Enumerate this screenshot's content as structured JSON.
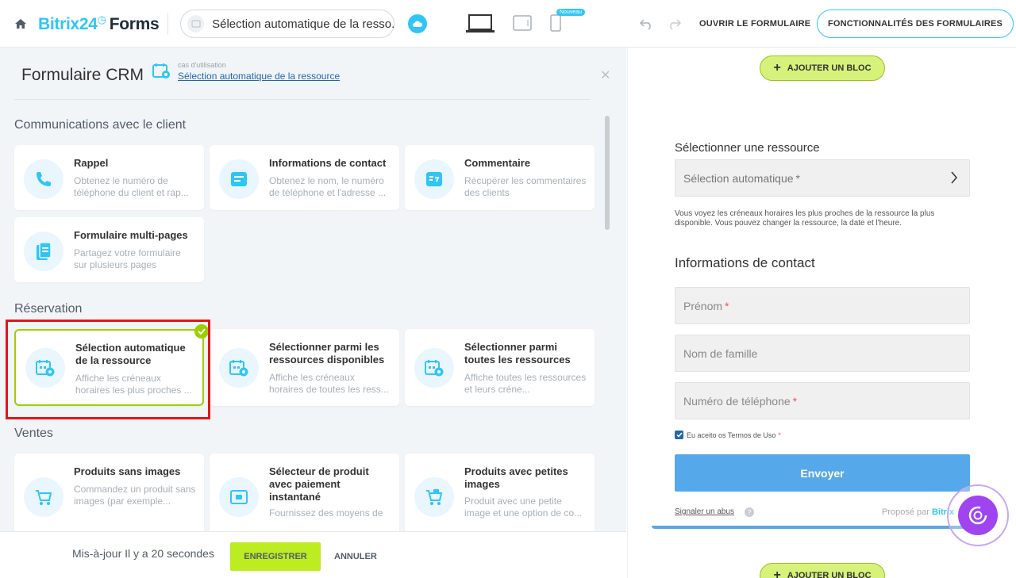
{
  "topbar": {
    "brand_name": "Bitrix24",
    "brand_forms": "Forms",
    "search_value": "Sélection automatique de la resso...",
    "new_badge": "Nouveau",
    "open_form": "OUVRIR LE FORMULAIRE",
    "features": "FONCTIONNALITÉS DES FORMULAIRES"
  },
  "left": {
    "title": "Formulaire CRM",
    "use_case_label": "cas d'utilisation",
    "use_case_link": "Sélection automatique de la ressource",
    "sections": [
      {
        "title": "Communications avec le client",
        "cards": [
          {
            "title": "Rappel",
            "desc": "Obtenez le numéro de téléphone du client et rap...",
            "icon": "phone-icon"
          },
          {
            "title": "Informations de contact",
            "desc": "Obtenez le nom, le numéro de téléphone et l'adresse ...",
            "icon": "contact-card-icon"
          },
          {
            "title": "Commentaire",
            "desc": "Récupérer les commentaires des clients",
            "icon": "comment-icon"
          },
          {
            "title": "Formulaire multi-pages",
            "desc": "Partagez votre formulaire sur plusieurs pages",
            "icon": "pages-icon"
          }
        ]
      },
      {
        "title": "Réservation",
        "cards": [
          {
            "title": "Sélection automatique de la ressource",
            "desc": "Affiche les créneaux horaires les plus proches ...",
            "icon": "calendar-resource-icon",
            "selected": true
          },
          {
            "title": "Sélectionner parmi les ressources disponibles",
            "desc": "Affiche les créneaux horaires de toutes les ress...",
            "icon": "calendar-resource-icon"
          },
          {
            "title": "Sélectionner parmi toutes les ressources",
            "desc": "Affiche toutes les ressources et leurs créne...",
            "icon": "calendar-resource-icon"
          }
        ]
      },
      {
        "title": "Ventes",
        "cards": [
          {
            "title": "Produits sans images",
            "desc": "Commandez un produit sans images (par exemple...",
            "icon": "cart-icon"
          },
          {
            "title": "Sélecteur de produit avec paiement instantané",
            "desc": "Fournissez des moyens de",
            "icon": "payment-icon"
          },
          {
            "title": "Produits avec petites images",
            "desc": "Produit avec une petite image et une option de co...",
            "icon": "cart-image-icon"
          }
        ]
      }
    ]
  },
  "bottom": {
    "status": "Mis-à-jour Il y a 20 secondes",
    "save": "ENREGISTRER",
    "cancel": "ANNULER"
  },
  "preview": {
    "add_block": "AJOUTER UN BLOC",
    "resource_heading": "Sélectionner une ressource",
    "resource_select": "Sélection automatique",
    "resource_note": "Vous voyez les créneaux horaires les plus proches de la ressource la plus disponible. Vous pouvez changer la ressource, la date et l'heure.",
    "contact_heading": "Informations de contact",
    "first_name": "Prénom",
    "last_name": "Nom de famille",
    "phone": "Numéro de téléphone",
    "terms": "Eu aceito os Termos de Uso",
    "submit": "Envoyer",
    "abuse": "Signaler un abus",
    "powered_by": "Proposé par",
    "powered_brand": "Bitrix"
  },
  "colors": {
    "brand": "#2fc6f6",
    "accent_green": "#bbed21",
    "selected_border": "#9dcf00",
    "highlight_red": "#e0161b",
    "submit_blue": "#55a8e9"
  }
}
